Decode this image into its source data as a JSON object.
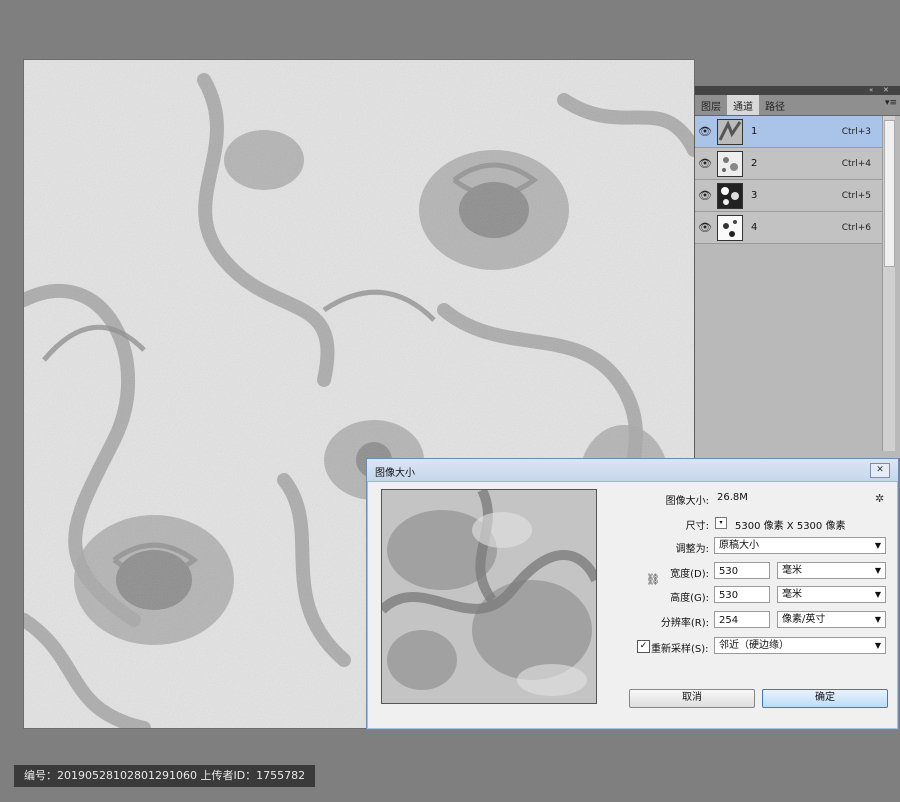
{
  "layers_panel": {
    "tabs": [
      "图层",
      "通道",
      "路径"
    ],
    "active_tab": 1,
    "layers": [
      {
        "name": "1",
        "shortcut": "Ctrl+3",
        "selected": true
      },
      {
        "name": "2",
        "shortcut": "Ctrl+4",
        "selected": false
      },
      {
        "name": "3",
        "shortcut": "Ctrl+5",
        "selected": false
      },
      {
        "name": "4",
        "shortcut": "Ctrl+6",
        "selected": false
      }
    ]
  },
  "dialog": {
    "title": "图像大小",
    "close_label": "✕",
    "image_size_label": "图像大小:",
    "image_size_value": "26.8M",
    "dimensions_label": "尺寸:",
    "dimensions_value": "5300 像素  X  5300 像素",
    "fit_to_label": "调整为:",
    "fit_to_value": "原稿大小",
    "width_label": "宽度(D):",
    "width_value": "530",
    "width_unit": "毫米",
    "height_label": "高度(G):",
    "height_value": "530",
    "height_unit": "毫米",
    "resolution_label": "分辨率(R):",
    "resolution_value": "254",
    "resolution_unit": "像素/英寸",
    "resample_label": "重新采样(S):",
    "resample_checked": true,
    "resample_value": "邻近（硬边缘）",
    "cancel_label": "取消",
    "ok_label": "确定"
  },
  "footer": {
    "text": "编号：20190528102801291060  上传者ID：1755782"
  }
}
